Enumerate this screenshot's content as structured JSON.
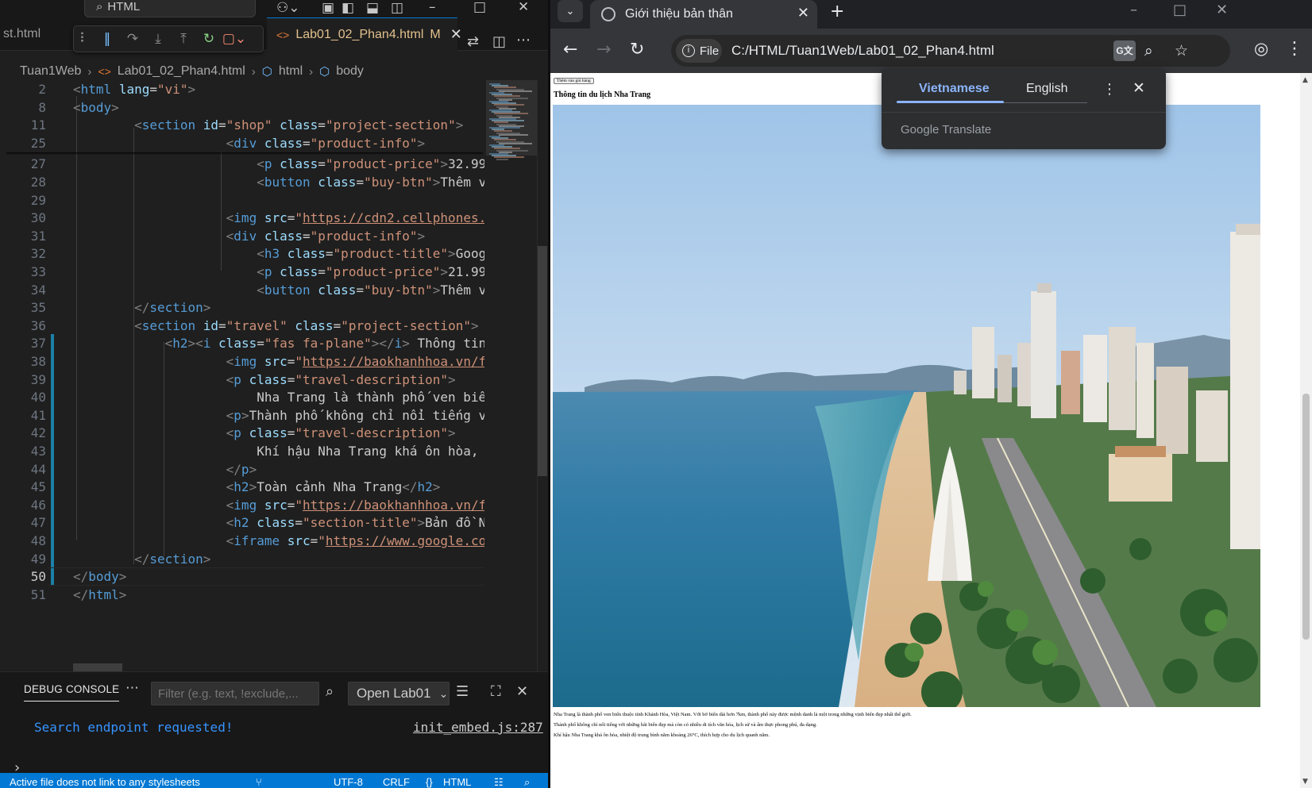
{
  "vscode": {
    "search_label": "HTML",
    "prev_tab_label": "st.html",
    "active_tab": {
      "label": "Lab01_02_Phan4.html",
      "modified": "M"
    },
    "breadcrumb": [
      "Tuan1Web",
      "Lab01_02_Phan4.html",
      "html",
      "body"
    ],
    "current_line": 50,
    "code_lines": [
      {
        "n": 2,
        "html": "<span class='t-punc'>&lt;</span><span class='t-tag'>html</span> <span class='t-attr'>lang</span>=<span class='t-str'>\"vi\"</span><span class='t-punc'>&gt;</span>"
      },
      {
        "n": 8,
        "html": "<span class='t-punc'>&lt;</span><span class='t-tag'>body</span><span class='t-punc'>&gt;</span>"
      },
      {
        "n": 11,
        "html": "        <span class='t-punc'>&lt;</span><span class='t-tag'>section</span> <span class='t-attr'>id</span>=<span class='t-str'>\"shop\"</span> <span class='t-attr'>class</span>=<span class='t-str'>\"project-section\"</span><span class='t-punc'>&gt;</span>"
      },
      {
        "n": 25,
        "html": "                    <span class='t-punc'>&lt;</span><span class='t-tag'>div</span> <span class='t-attr'>class</span>=<span class='t-str'>\"product-info\"</span><span class='t-punc'>&gt;</span>"
      },
      {
        "n": 27,
        "html": "                        <span class='t-punc'>&lt;</span><span class='t-tag'>p</span> <span class='t-attr'>class</span>=<span class='t-str'>\"product-price\"</span><span class='t-punc'>&gt;</span>32.99"
      },
      {
        "n": 28,
        "html": "                        <span class='t-punc'>&lt;</span><span class='t-tag'>button</span> <span class='t-attr'>class</span>=<span class='t-str'>\"buy-btn\"</span><span class='t-punc'>&gt;</span>Thêm v"
      },
      {
        "n": 29,
        "html": ""
      },
      {
        "n": 30,
        "html": "                    <span class='t-punc'>&lt;</span><span class='t-tag'>img</span> <span class='t-attr'>src</span>=<span class='t-str'>\"</span><span class='t-url'>https://cdn2.cellphones.</span>"
      },
      {
        "n": 31,
        "html": "                    <span class='t-punc'>&lt;</span><span class='t-tag'>div</span> <span class='t-attr'>class</span>=<span class='t-str'>\"product-info\"</span><span class='t-punc'>&gt;</span>"
      },
      {
        "n": 32,
        "html": "                        <span class='t-punc'>&lt;</span><span class='t-tag'>h3</span> <span class='t-attr'>class</span>=<span class='t-str'>\"product-title\"</span><span class='t-punc'>&gt;</span>Goog"
      },
      {
        "n": 33,
        "html": "                        <span class='t-punc'>&lt;</span><span class='t-tag'>p</span> <span class='t-attr'>class</span>=<span class='t-str'>\"product-price\"</span><span class='t-punc'>&gt;</span>21.99("
      },
      {
        "n": 34,
        "html": "                        <span class='t-punc'>&lt;</span><span class='t-tag'>button</span> <span class='t-attr'>class</span>=<span class='t-str'>\"buy-btn\"</span><span class='t-punc'>&gt;</span>Thêm v"
      },
      {
        "n": 35,
        "html": "        <span class='t-punc'>&lt;/</span><span class='t-tag'>section</span><span class='t-punc'>&gt;</span>"
      },
      {
        "n": 36,
        "html": "        <span class='t-punc'>&lt;</span><span class='t-tag'>section</span> <span class='t-attr'>id</span>=<span class='t-str'>\"travel\"</span> <span class='t-attr'>class</span>=<span class='t-str'>\"project-section\"</span><span class='t-punc'>&gt;</span>"
      },
      {
        "n": 37,
        "html": "            <span class='t-punc'>&lt;</span><span class='t-tag'>h2</span><span class='t-punc'>&gt;&lt;</span><span class='t-tag'>i</span> <span class='t-attr'>class</span>=<span class='t-str'>\"fas fa-plane\"</span><span class='t-punc'>&gt;&lt;/</span><span class='t-tag'>i</span><span class='t-punc'>&gt;</span> Thông tin"
      },
      {
        "n": 38,
        "html": "                    <span class='t-punc'>&lt;</span><span class='t-tag'>img</span> <span class='t-attr'>src</span>=<span class='t-str'>\"</span><span class='t-url'>https://baokhanhhoa.vn/f</span>"
      },
      {
        "n": 39,
        "html": "                    <span class='t-punc'>&lt;</span><span class='t-tag'>p</span> <span class='t-attr'>class</span>=<span class='t-str'>\"travel-description\"</span><span class='t-punc'>&gt;</span>"
      },
      {
        "n": 40,
        "html": "                        Nha Trang là thành phố ven biể"
      },
      {
        "n": 41,
        "html": "                    <span class='t-punc'>&lt;</span><span class='t-tag'>p</span><span class='t-punc'>&gt;</span>Thành phố không chỉ nổi tiếng v"
      },
      {
        "n": 42,
        "html": "                    <span class='t-punc'>&lt;</span><span class='t-tag'>p</span> <span class='t-attr'>class</span>=<span class='t-str'>\"travel-description\"</span><span class='t-punc'>&gt;</span>"
      },
      {
        "n": 43,
        "html": "                        Khí hậu Nha Trang khá ôn hòa,"
      },
      {
        "n": 44,
        "html": "                    <span class='t-punc'>&lt;/</span><span class='t-tag'>p</span><span class='t-punc'>&gt;</span>"
      },
      {
        "n": 45,
        "html": "                    <span class='t-punc'>&lt;</span><span class='t-tag'>h2</span><span class='t-punc'>&gt;</span>Toàn cảnh Nha Trang<span class='t-punc'>&lt;/</span><span class='t-tag'>h2</span><span class='t-punc'>&gt;</span>"
      },
      {
        "n": 46,
        "html": "                    <span class='t-punc'>&lt;</span><span class='t-tag'>img</span> <span class='t-attr'>src</span>=<span class='t-str'>\"</span><span class='t-url'>https://baokhanhhoa.vn/f</span>"
      },
      {
        "n": 47,
        "html": "                    <span class='t-punc'>&lt;</span><span class='t-tag'>h2</span> <span class='t-attr'>class</span>=<span class='t-str'>\"section-title\"</span><span class='t-punc'>&gt;</span>Bản đồ N"
      },
      {
        "n": 48,
        "html": "                    <span class='t-punc'>&lt;</span><span class='t-tag'>iframe</span> <span class='t-attr'>src</span>=<span class='t-str'>\"</span><span class='t-url'>https://www.google.co</span>"
      },
      {
        "n": 49,
        "html": "        <span class='t-punc'>&lt;/</span><span class='t-tag'>section</span><span class='t-punc'>&gt;</span>"
      },
      {
        "n": 50,
        "html": "<span class='t-punc'>&lt;/</span><span class='t-tag'>body</span><span class='t-punc'>&gt;</span>"
      },
      {
        "n": 51,
        "html": "<span class='t-punc'>&lt;/</span><span class='t-tag'>html</span><span class='t-punc'>&gt;</span>"
      }
    ],
    "panel": {
      "tab_label": "DEBUG CONSOLE",
      "filter_placeholder": "Filter (e.g. text, !exclude,...",
      "session_select": "Open Lab01",
      "message": "Search endpoint requested!",
      "message_source": "init_embed.js:287"
    },
    "statusbar": {
      "message": "Active file does not link to any stylesheets",
      "encoding": "UTF-8",
      "eol": "CRLF",
      "language": "HTML"
    }
  },
  "chrome": {
    "tab_title": "Giới thiệu bản thân",
    "omnibox_chip": "File",
    "url": "C:/HTML/Tuan1Web/Lab01_02_Phan4.html",
    "translate_popup": {
      "lang_source": "Vietnamese",
      "lang_target": "English",
      "brand": "Google Translate"
    },
    "page": {
      "button_label": "Thêm vào giỏ hàng",
      "heading": "Thông tin du lịch Nha Trang",
      "paragraphs": [
        "Nha Trang là thành phố ven biển thuộc tỉnh Khánh Hòa, Việt Nam. Với bờ biển dài hơn 7km, thành phố này được mệnh danh là một trong những vịnh biển đẹp nhất thế giới.",
        "Thành phố không chỉ nổi tiếng với những bãi biển đẹp mà còn có nhiều di tích văn hóa, lịch sử và ẩm thực phong phú, đa dạng.",
        "Khí hậu Nha Trang khá ôn hòa, nhiệt độ trung bình năm khoảng 26°C, thích hợp cho du lịch quanh năm."
      ]
    }
  }
}
